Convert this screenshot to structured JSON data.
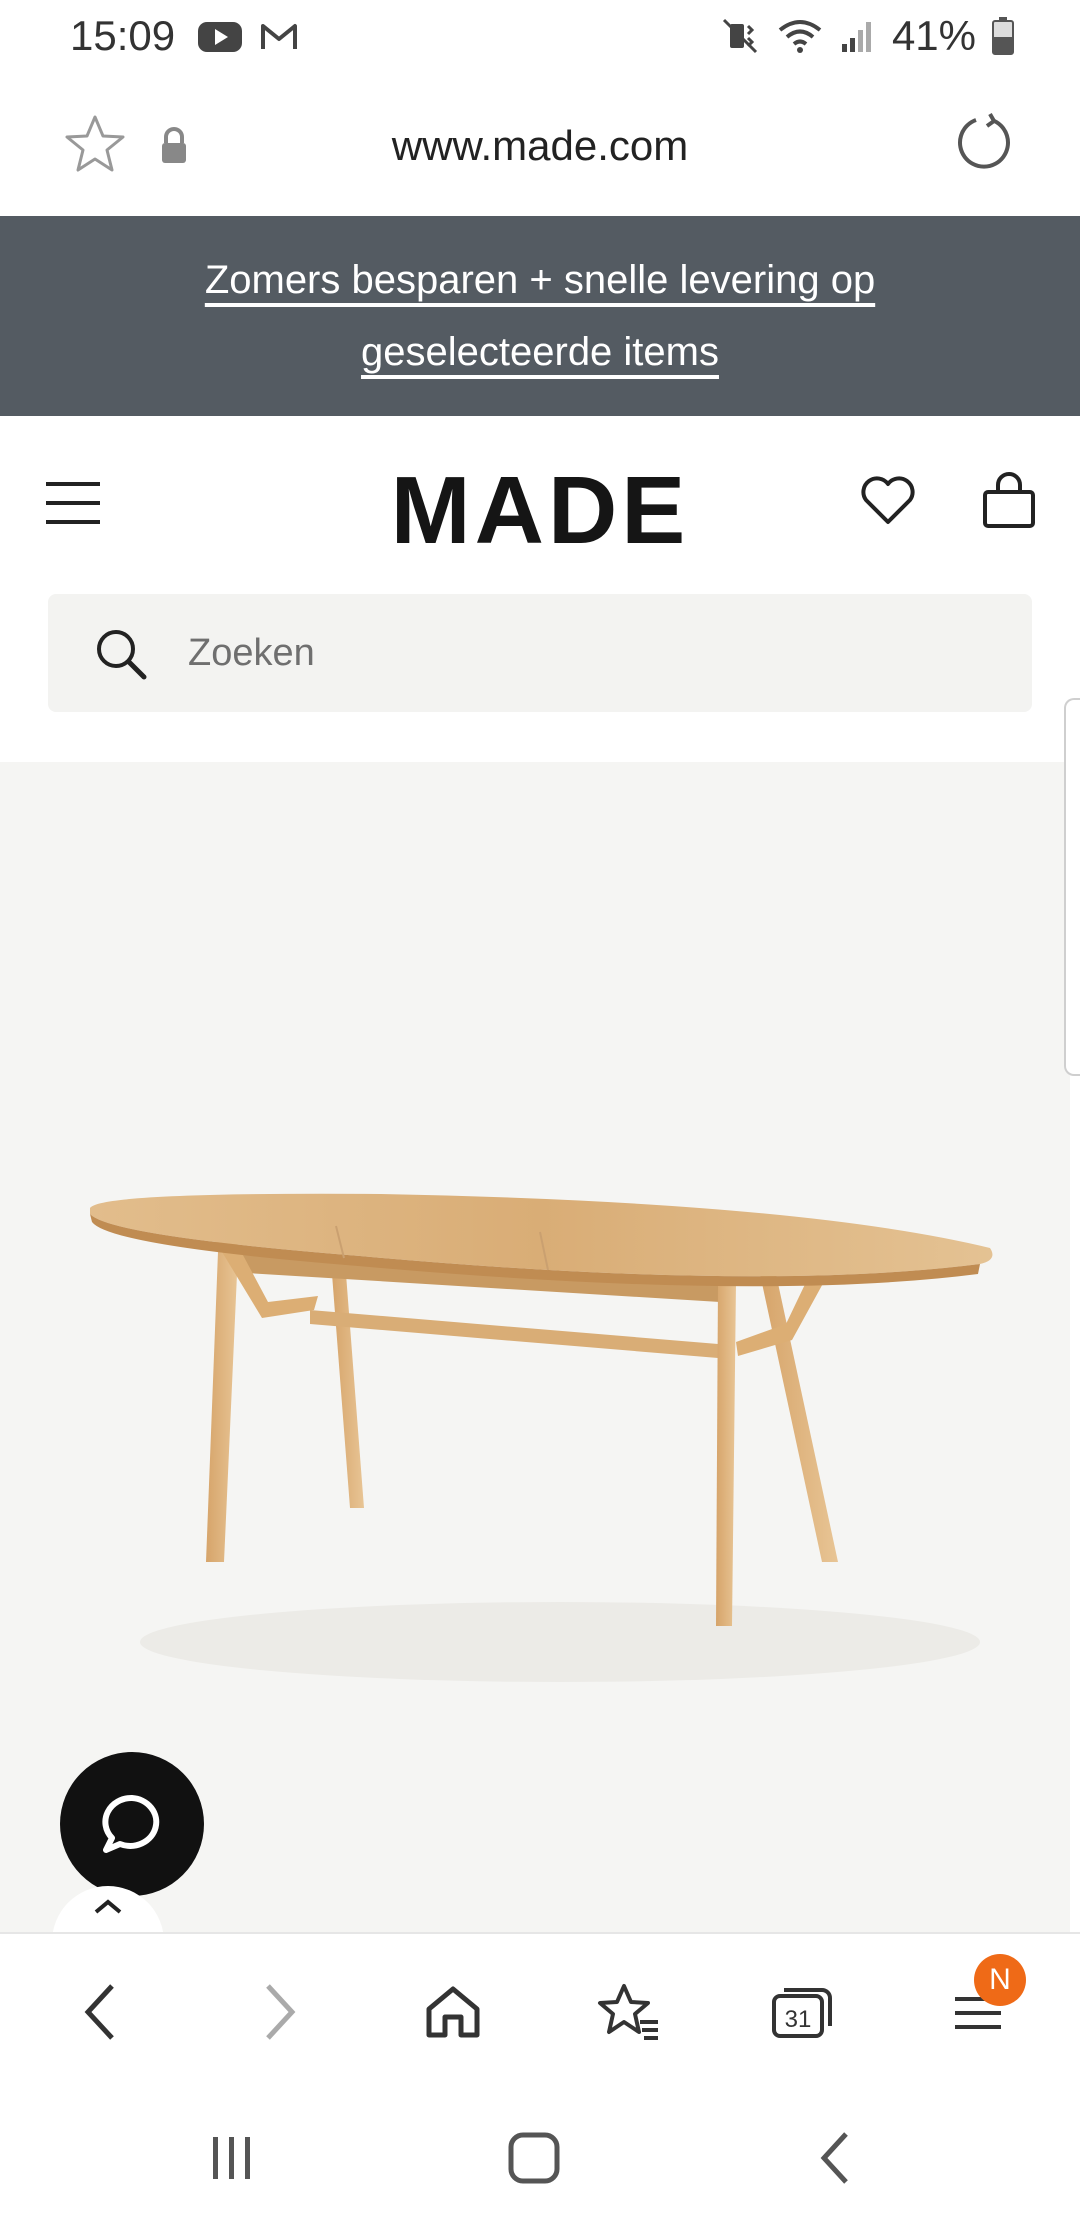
{
  "status_bar": {
    "time": "15:09",
    "battery": "41%",
    "icons": [
      "youtube-icon",
      "gmail-icon",
      "mute-icon",
      "wifi-icon",
      "signal-icon",
      "battery-icon"
    ]
  },
  "browser": {
    "url": "www.made.com",
    "icons": [
      "star-icon",
      "lock-icon",
      "reload-icon"
    ]
  },
  "promo": {
    "text": "Zomers besparen + snelle levering op geselecteerde items"
  },
  "header": {
    "logo": "MADE",
    "icons": [
      "menu-icon",
      "heart-icon",
      "bag-icon"
    ]
  },
  "search": {
    "placeholder": "Zoeken"
  },
  "bottom_nav": {
    "items": [
      "back-icon",
      "forward-icon",
      "home-icon",
      "bookmarks-icon",
      "tabs-icon",
      "menu-icon"
    ],
    "tabs_count": "31",
    "badge": "N"
  },
  "colors": {
    "promo_bg": "#545b62",
    "search_bg": "#f3f3f1",
    "product_bg": "#f5f5f3",
    "badge": "#ef6a17",
    "wood": "#d9ad76"
  }
}
